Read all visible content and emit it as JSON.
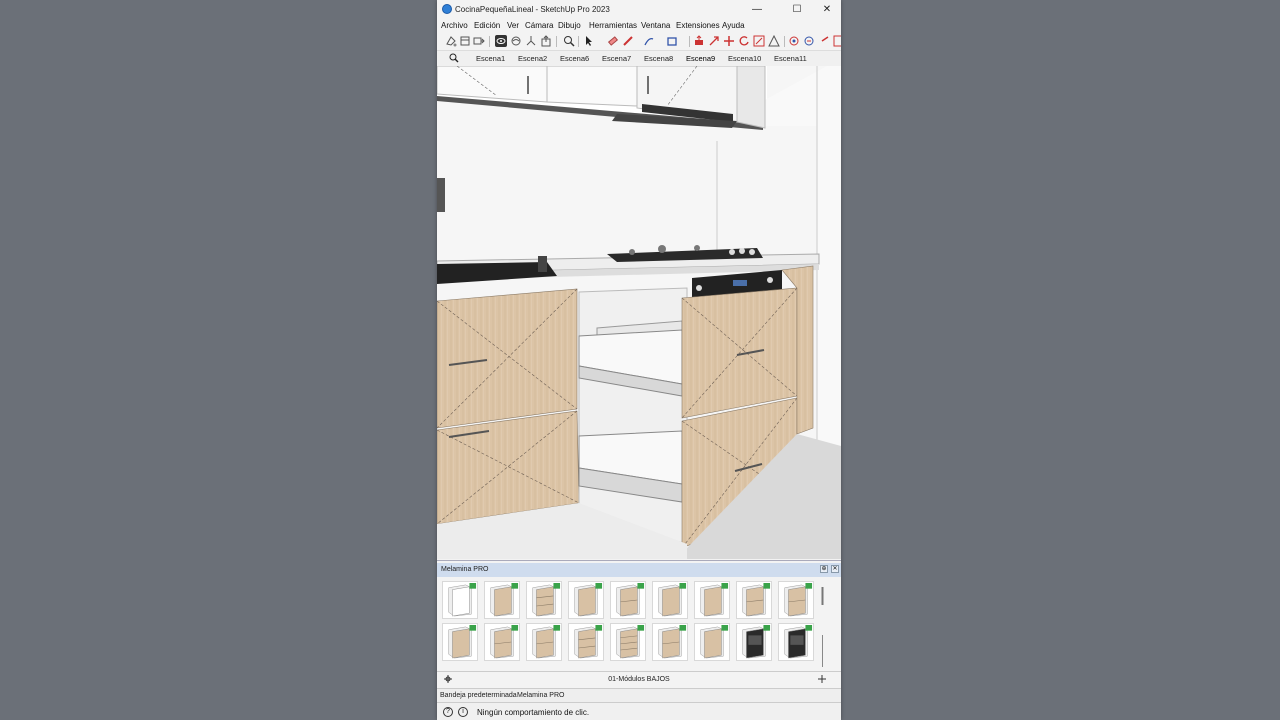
{
  "window": {
    "title": "CocinaPequeñaLineal - SketchUp Pro 2023",
    "minimize_glyph": "—",
    "maximize_glyph": "☐",
    "close_glyph": "✕"
  },
  "menu": {
    "items": [
      "Archivo",
      "Edición",
      "Ver",
      "Cámara",
      "Dibujo",
      "Herramientas",
      "Ventana",
      "Extensiones",
      "Ayuda"
    ]
  },
  "toolbar": {
    "icons": [
      "paint-bucket-icon",
      "components-icon",
      "styles-icon",
      "orbit-tool-icon",
      "pan-tool-icon",
      "zoom-extents-icon",
      "export-icon",
      "zoom-icon",
      "select-arrow-icon",
      "eraser-icon",
      "pencil-icon",
      "line-icon",
      "rectangle-icon",
      "push-pull-icon",
      "move-icon",
      "rotate-icon",
      "scale-icon",
      "offset-icon",
      "tape-measure-icon",
      "dimension-icon",
      "text-icon",
      "section-icon"
    ]
  },
  "scenes": {
    "search_icon": "search-icon",
    "tabs": [
      "Escena1",
      "Escena2",
      "Escena6",
      "Escena7",
      "Escena8",
      "Escena9",
      "Escena10",
      "Escena11"
    ],
    "active": "Escena9"
  },
  "tray": {
    "title": "Melamina PRO",
    "pin_glyph": "⊕",
    "close_glyph": "✕",
    "folder_label": "01-Módulos BAJOS",
    "row1": [
      "empty-carcass",
      "two-door",
      "three-drawer",
      "door-tall",
      "two-drawer",
      "door-left",
      "door-right",
      "one-drawer-door",
      "door-drawer"
    ],
    "row2": [
      "double-door",
      "two-drawer-a",
      "two-drawer-b",
      "three-drawer-b",
      "four-drawer",
      "two-drawer-c",
      "corner-unit",
      "oven-unit",
      "oven-microwave"
    ],
    "colors": {
      "wood": "#d8c1a4",
      "dark": "#2a2a2a",
      "accent": "#3aa34a"
    }
  },
  "tray_tabs": [
    "Bandeja predeterminada",
    "Melamina PRO"
  ],
  "status": {
    "text": "Ningún comportamiento de clic.",
    "geo_icon": "location-icon",
    "info_icon": "info-icon"
  }
}
